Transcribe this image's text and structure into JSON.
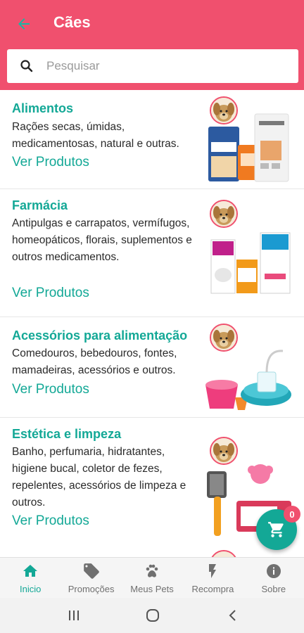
{
  "header": {
    "title": "Cães",
    "back_icon": "arrow-left-icon",
    "bg_color": "#f0506e"
  },
  "search": {
    "placeholder": "Pesquisar",
    "value": "",
    "icon": "search-icon"
  },
  "categories": [
    {
      "title": "Alimentos",
      "description": "Rações secas, úmidas, medicamentosas, natural e outras.",
      "link": "Ver Produtos",
      "image_icon": "dog-food-bags-icon"
    },
    {
      "title": "Farmácia",
      "description": "Antipulgas e carrapatos, vermífugos, homeopáticos, florais, suplementos e outros medicamentos.",
      "link": "Ver Produtos",
      "image_icon": "pet-medicine-boxes-icon"
    },
    {
      "title": "Acessórios para alimentação",
      "description": "Comedouros, bebedouros, fontes, mamadeiras, acessórios e outros.",
      "link": "Ver Produtos",
      "image_icon": "pet-bowls-fountain-icon"
    },
    {
      "title": "Estética e limpeza",
      "description": "Banho, perfumaria, hidratantes, higiene bucal, coletor de fezes, repelentes, acessórios de limpeza e outros.",
      "link": "Ver Produtos",
      "image_icon": "grooming-brush-wipes-icon"
    }
  ],
  "cart": {
    "count": "0",
    "icon": "cart-icon"
  },
  "bottom_nav": [
    {
      "label": "Inicio",
      "icon": "home-icon",
      "active": true
    },
    {
      "label": "Promoções",
      "icon": "tags-icon",
      "active": false
    },
    {
      "label": "Meus Pets",
      "icon": "paw-icon",
      "active": false
    },
    {
      "label": "Recompra",
      "icon": "bolt-icon",
      "active": false
    },
    {
      "label": "Sobre",
      "icon": "info-icon",
      "active": false
    }
  ],
  "colors": {
    "accent": "#13a896",
    "primary": "#f0506e"
  }
}
